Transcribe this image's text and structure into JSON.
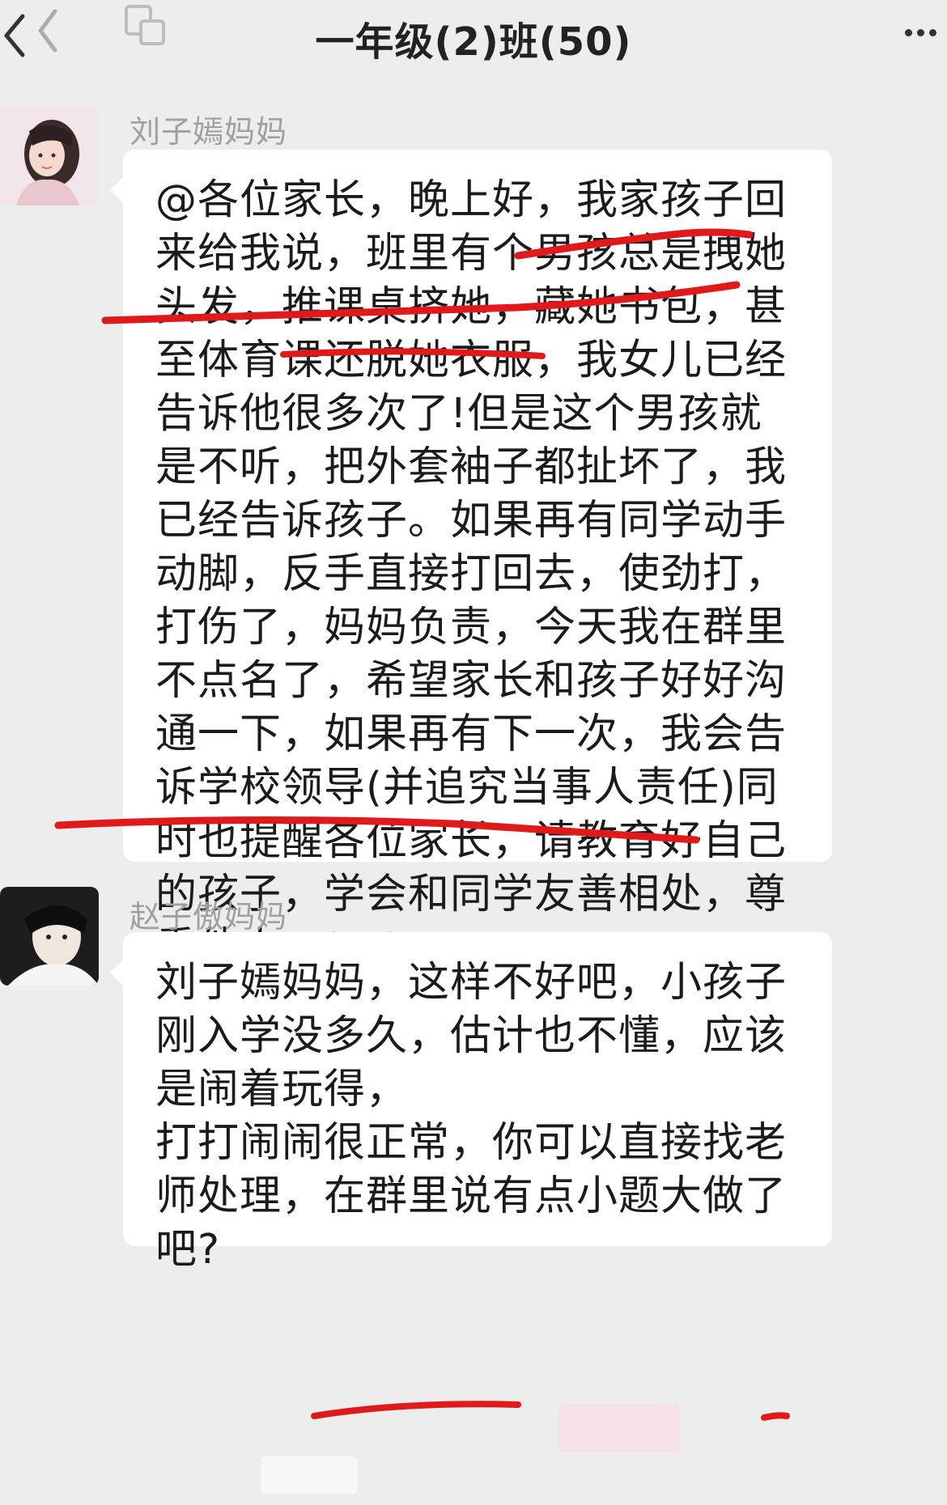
{
  "header": {
    "title": "一年级(2)班(50)",
    "back_icon": "chevron-left-icon",
    "window_icon": "floating-window-icon",
    "more_icon": "more-dots-icon"
  },
  "messages": [
    {
      "sender": "刘子嫣妈妈",
      "avatar": "avatar-girl-photo",
      "text": "@各位家长，晚上好，我家孩子回来给我说，班里有个男孩总是拽她头发，推课桌挤她，藏她书包，甚至体育课还脱她衣服，我女儿已经告诉他很多次了!但是这个男孩就是不听，把外套袖子都扯坏了，我已经告诉孩子。如果再有同学动手动脚，反手直接打回去，使劲打，打伤了，妈妈负责，今天我在群里不点名了，希望家长和孩子好好沟通一下，如果再有下一次，我会告诉学校领导(并追究当事人责任)同时也提醒各位家长，请教育好自己的孩子，学会和同学友善相处，尊重他人",
      "emoji": "banana-emoji"
    },
    {
      "sender": "赵子傲妈妈",
      "avatar": "avatar-person-photo",
      "text": "刘子嫣妈妈，这样不好吧，小孩子刚入学没多久，估计也不懂，应该是闹着玩得，\n打打闹闹很正常，你可以直接找老师处理，在群里说有点小题大做了吧?"
    }
  ],
  "colors": {
    "background": "#ededed",
    "bubble": "#ffffff",
    "sender_text": "#a0a0a0",
    "annotation_red": "#e0191b"
  }
}
